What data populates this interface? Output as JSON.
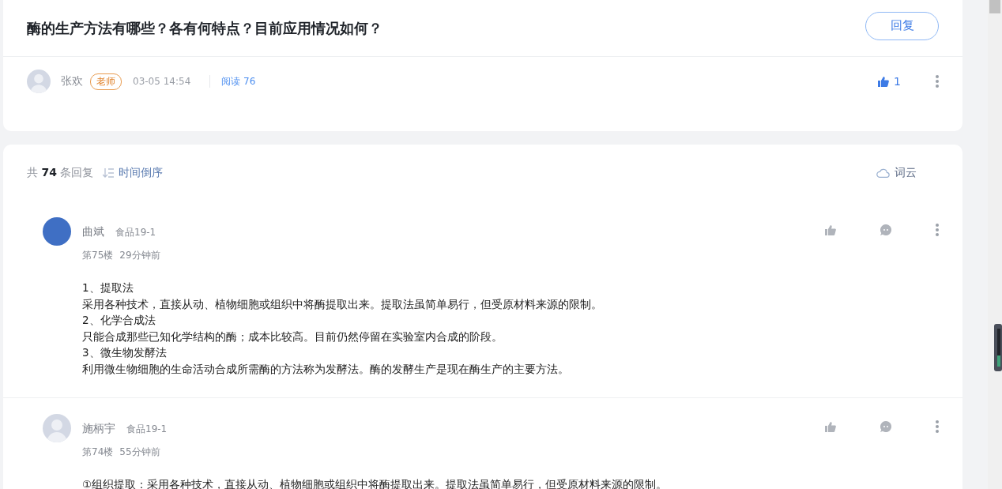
{
  "post": {
    "title": "酶的生产方法有哪些？各有何特点？目前应用情况如何？",
    "reply_button": "回复",
    "author": "张欢",
    "role_badge": "老师",
    "time": "03-05 14:54",
    "reads": "阅读 76",
    "likes": "1",
    "liked": true
  },
  "replies_header": {
    "prefix": "共",
    "count": "74",
    "suffix": "条回复",
    "sort": "时间倒序",
    "word_cloud": "词云"
  },
  "replies": [
    {
      "name": "曲斌",
      "class": "食品19-1",
      "floor": "第75楼",
      "time": "29分钟前",
      "kind": "photo",
      "liked": false,
      "lines": [
        "1、提取法",
        "采用各种技术，直接从动、植物细胞或组织中将酶提取出来。提取法虽简单易行，但受原材料来源的限制。",
        "2、化学合成法",
        "只能合成那些已知化学结构的酶；成本比较高。目前仍然停留在实验室内合成的阶段。",
        "3、微生物发酵法",
        "利用微生物细胞的生命活动合成所需酶的方法称为发酵法。酶的发酵生产是现在酶生产的主要方法。"
      ]
    },
    {
      "name": "施柄宇",
      "class": "食品19-1",
      "floor": "第74楼",
      "time": "55分钟前",
      "kind": "default",
      "liked": false,
      "lines": [
        "①组织提取：采用各种技术，直接从动、植物细胞或组织中将酶提取出来。提取法虽简单易行，但受原材料来源的限制。"
      ]
    }
  ]
}
